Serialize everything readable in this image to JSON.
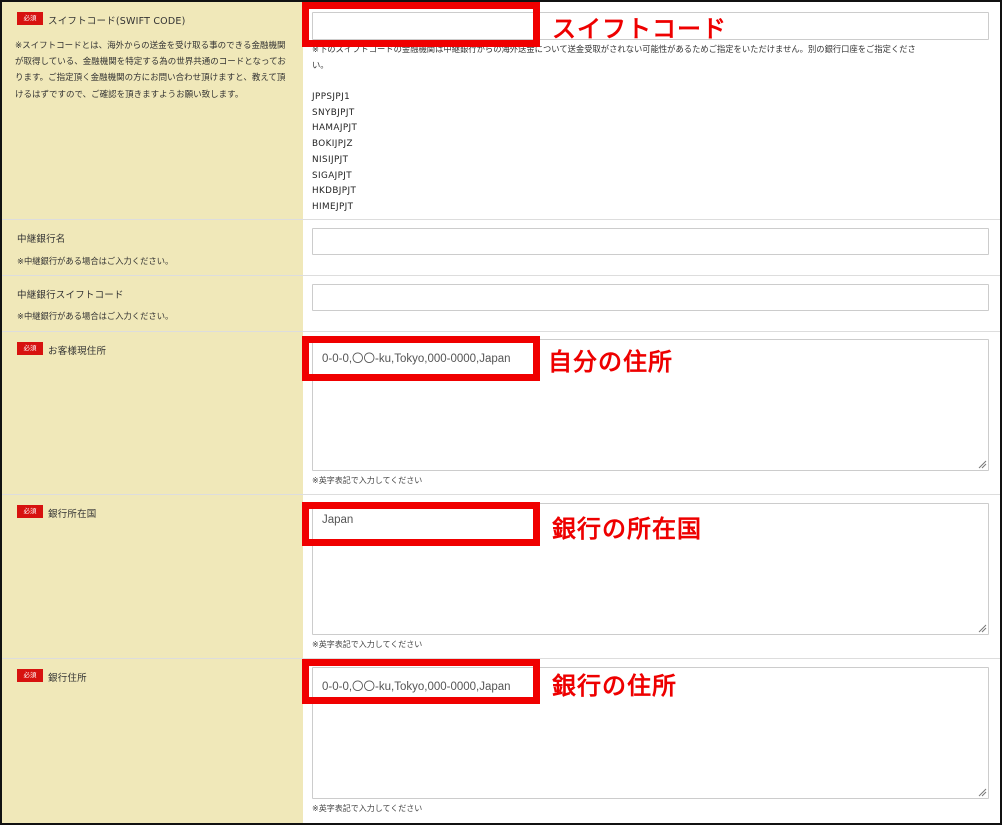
{
  "required_badge": "必須",
  "swift": {
    "label": "スイフトコード(SWIFT CODE)",
    "description_lines": [
      "※スイフトコードとは、海外からの送金を受け取る事のできる金融機関",
      "が取得している、金融機関を特定する為の世界共通のコードとなってお",
      "ります。ご指定頂く金融機関の方にお問い合わせ頂けますと、教えて頂",
      "けるはずですので、ご確認を頂きますようお願い致します。"
    ],
    "input_value": "",
    "note_line1": "※下のスイフトコードの金融機関は中継銀行からの海外送金について送金受取がされない可能性があるためご指定をいただけません。別の銀行口座をご指定くださ",
    "note_line2": "い。",
    "excluded_codes": [
      "JPPSJPJ1",
      "SNYBJPJT",
      "HAMAJPJT",
      "BOKIJPJZ",
      "NISIJPJT",
      "SIGAJPJT",
      "HKDBJPJT",
      "HIMEJPJT"
    ],
    "annotation": "スイフトコード"
  },
  "intermediary_bank": {
    "label": "中継銀行名",
    "note": "※中継銀行がある場合はご入力ください。",
    "input_value": ""
  },
  "intermediary_swift": {
    "label": "中継銀行スイフトコード",
    "note": "※中継銀行がある場合はご入力ください。",
    "input_value": ""
  },
  "customer_address": {
    "label": "お客様現住所",
    "textarea_value": "0-0-0,〇〇-ku,Tokyo,000-0000,Japan",
    "field_note": "※英字表記で入力してください",
    "annotation": "自分の住所"
  },
  "bank_country": {
    "label": "銀行所在国",
    "textarea_value": "Japan",
    "field_note": "※英字表記で入力してください",
    "annotation": "銀行の所在国"
  },
  "bank_address": {
    "label": "銀行住所",
    "textarea_value": "0-0-0,〇〇-ku,Tokyo,000-0000,Japan",
    "field_note": "※英字表記で入力してください",
    "annotation": "銀行の住所"
  },
  "colors": {
    "label_background": "#f0e8b9",
    "required_badge": "#d7120f",
    "highlight": "#f00000",
    "annotation_text": "#ee0000"
  }
}
